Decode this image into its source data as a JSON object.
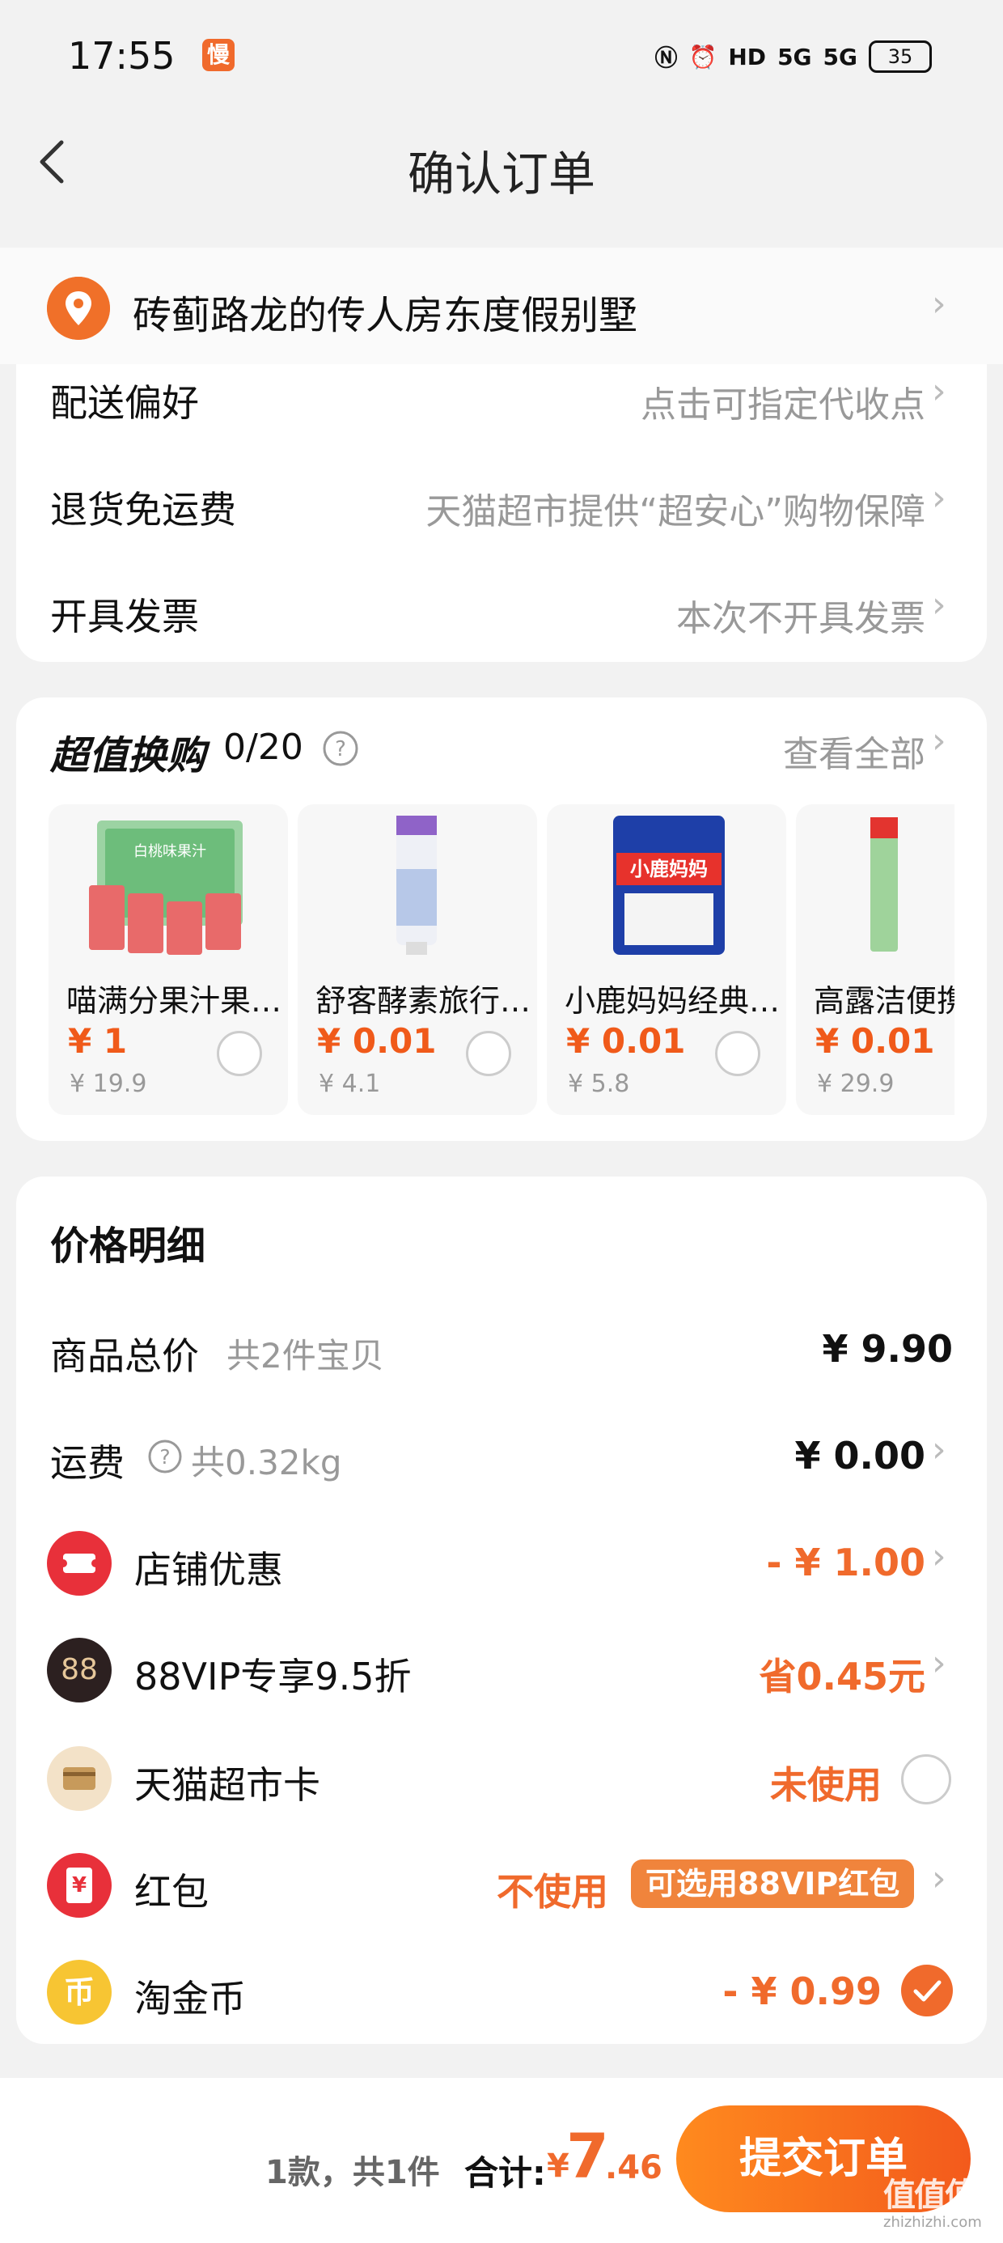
{
  "status_bar": {
    "time": "17:55",
    "app_badge": "慢",
    "battery": "35",
    "net1": "5G",
    "net2": "5G",
    "hd": "HD"
  },
  "nav": {
    "title": "确认订单"
  },
  "address": {
    "text": "砖蓟路龙的传人房东度假别墅"
  },
  "delivery": {
    "rows": [
      {
        "label": "配送偏好",
        "value": "点击可指定代收点"
      },
      {
        "label": "退货免运费",
        "value": "天猫超市提供“超安心”购物保障"
      },
      {
        "label": "开具发票",
        "value": "本次不开具发票"
      }
    ]
  },
  "exchange": {
    "title": "超值换购",
    "count": "0/20",
    "view_all": "查看全部",
    "items": [
      {
        "name": "喵满分果汁果…",
        "price": "¥ 1",
        "orig": "¥ 19.9"
      },
      {
        "name": "舒客酵素旅行…",
        "price": "¥ 0.01",
        "orig": "¥ 4.1"
      },
      {
        "name": "小鹿妈妈经典…",
        "price": "¥ 0.01",
        "orig": "¥ 5.8"
      },
      {
        "name": "高露洁便携",
        "price": "¥ 0.01",
        "orig": "¥ 29.9"
      }
    ],
    "product_labels": [
      "白桃味果汁",
      "小鹿妈妈"
    ]
  },
  "price_detail": {
    "title": "价格明细",
    "total_label": "商品总价",
    "total_sub": "共2件宝贝",
    "total_value": "¥ 9.90",
    "shipping_label": "运费",
    "shipping_sub": "共0.32kg",
    "shipping_value": "¥ 0.00",
    "shop_discount_label": "店铺优惠",
    "shop_discount_value": "- ¥ 1.00",
    "vip_label": "88VIP专享9.5折",
    "vip_value": "省0.45元",
    "vip_icon_text": "88",
    "card_label": "天猫超市卡",
    "card_value": "未使用",
    "redpack_label": "红包",
    "redpack_value": "不使用",
    "redpack_tag": "可选用88VIP红包",
    "redpack_icon_text": "¥",
    "coin_label": "淘金币",
    "coin_value": "- ¥ 0.99",
    "coin_icon_text": "币"
  },
  "footer": {
    "summary": "1款，共1件",
    "total_label": "合计:",
    "currency": "¥",
    "total_int": "7",
    "total_dec": ".46",
    "submit": "提交订单",
    "watermark": "值值值",
    "watermark_sub": "zhizhizhi.com"
  },
  "colors": {
    "accent": "#f06a2c",
    "price_red": "#f05a1a"
  }
}
